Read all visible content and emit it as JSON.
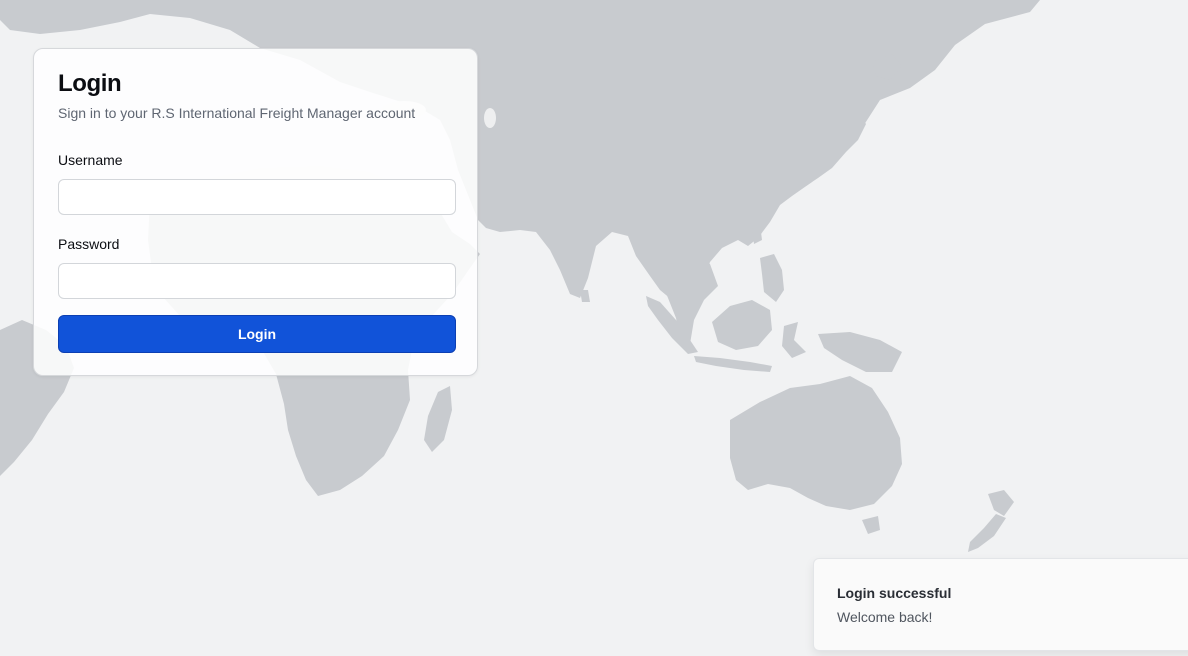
{
  "login_card": {
    "title": "Login",
    "subtitle": "Sign in to your R.S International Freight Manager account",
    "username": {
      "label": "Username",
      "value": "",
      "placeholder": ""
    },
    "password": {
      "label": "Password",
      "value": "",
      "placeholder": ""
    },
    "submit_label": "Login"
  },
  "toast": {
    "title": "Login successful",
    "description": "Welcome back!"
  },
  "colors": {
    "primary_button": "#1153d9",
    "background": "#f1f2f3",
    "map_land": "#c8cbcf"
  },
  "background": {
    "icon": "world-map"
  }
}
